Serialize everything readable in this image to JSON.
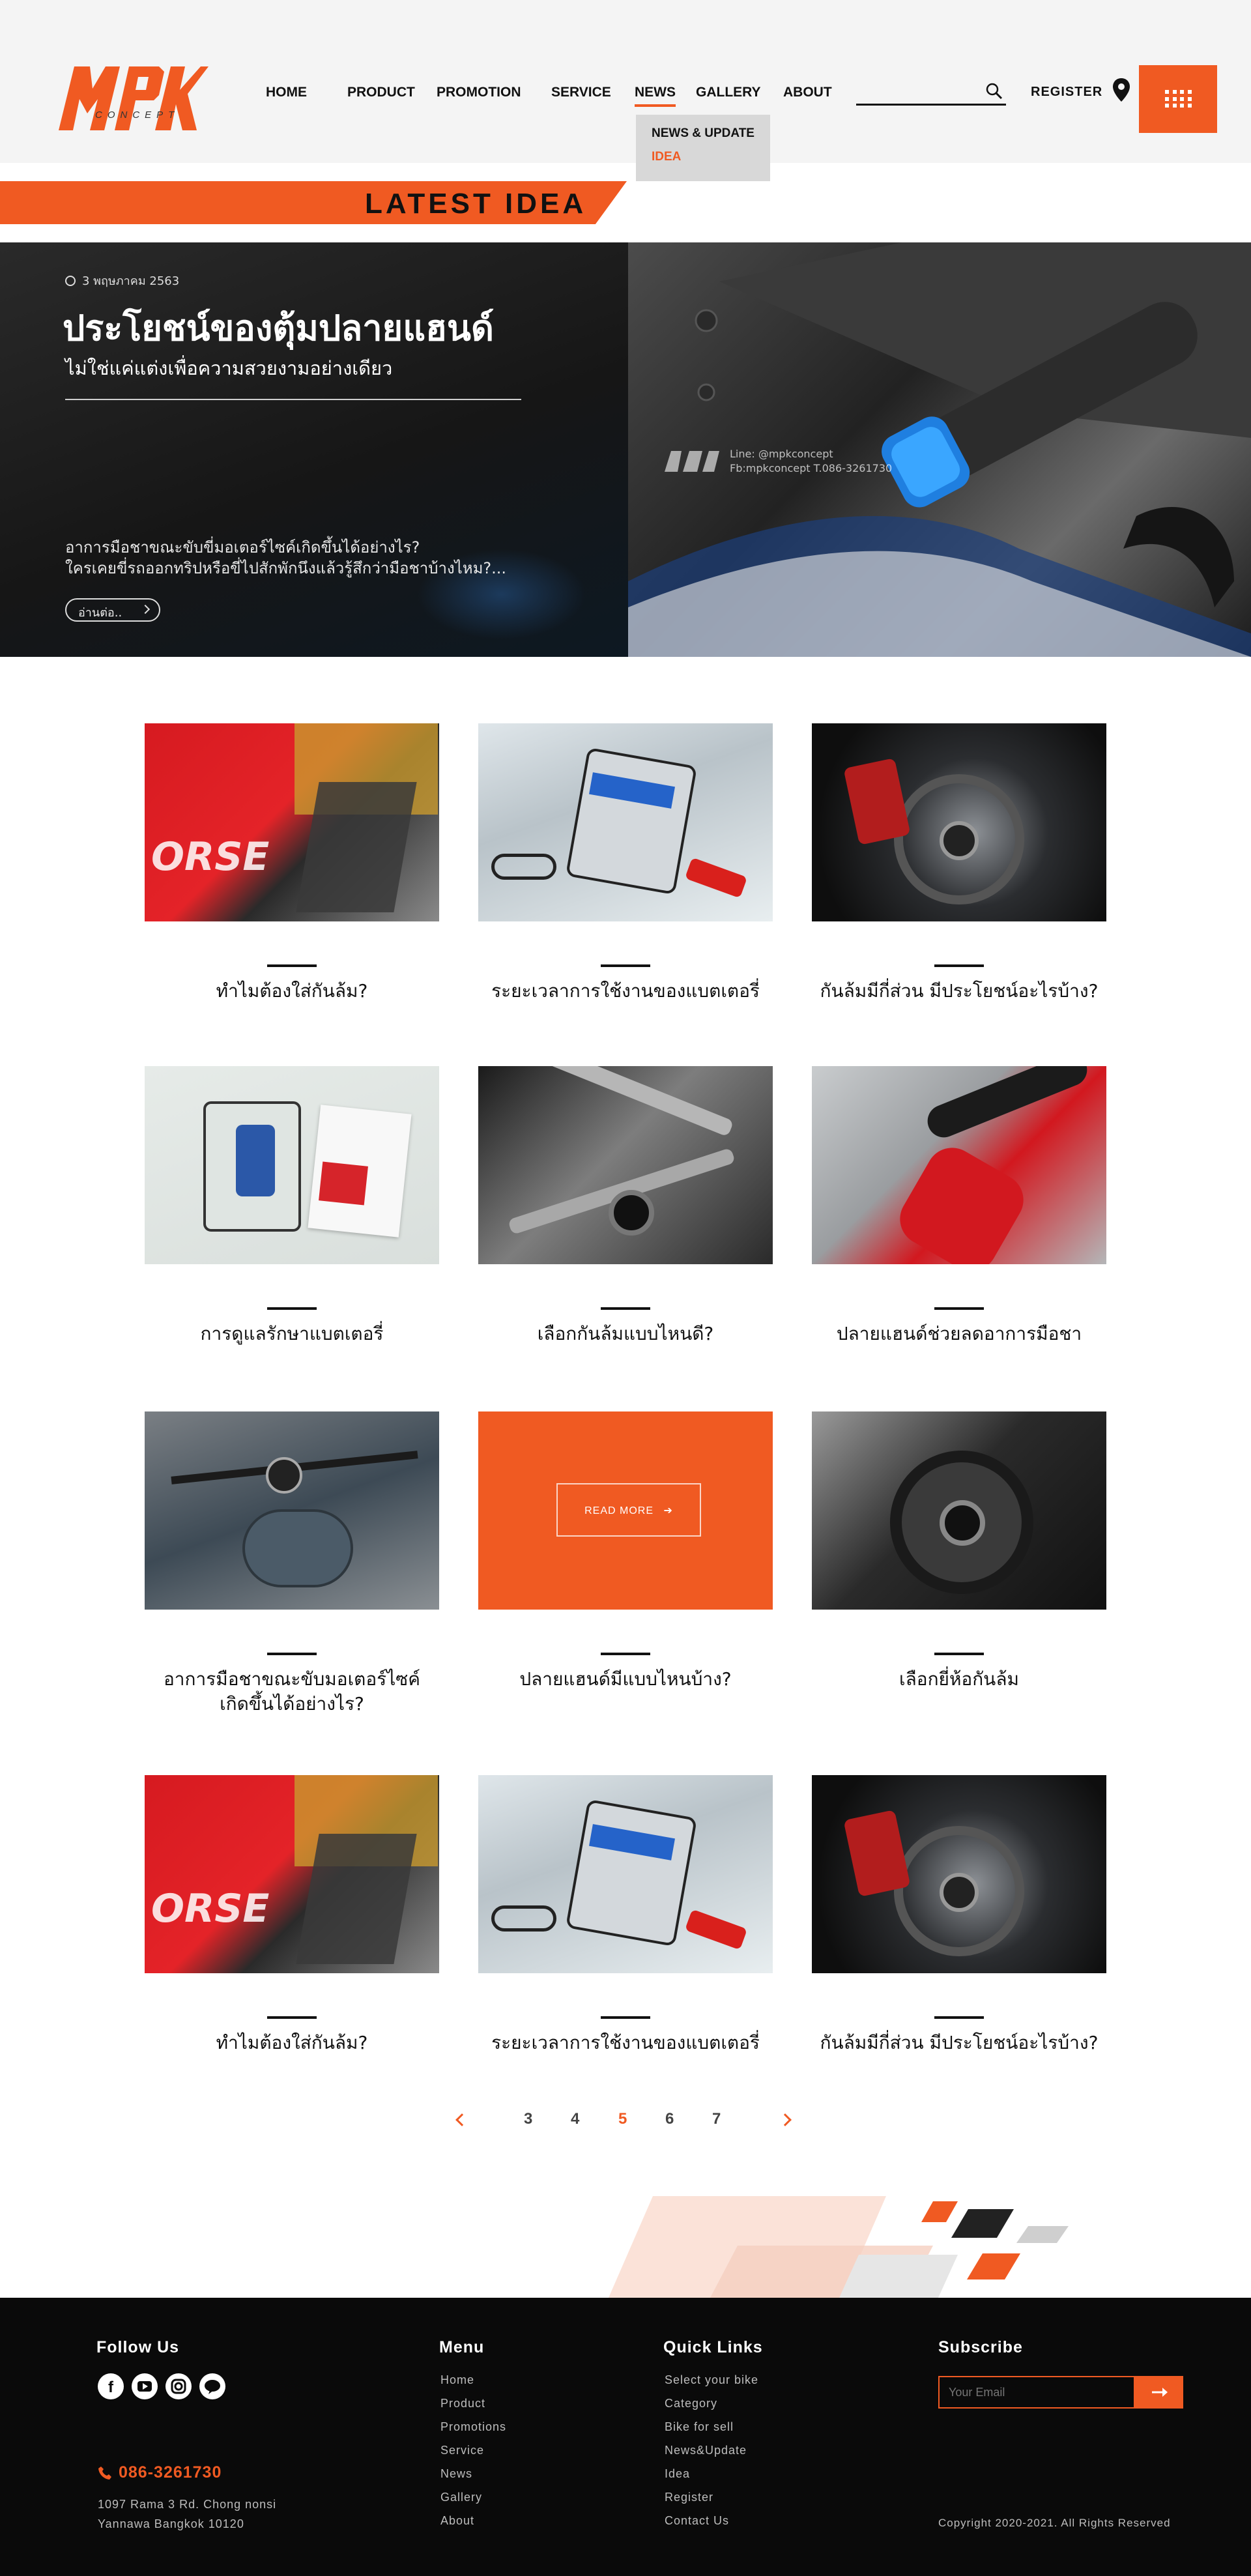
{
  "brand": {
    "logo_text": "MPK",
    "logo_sub": "CONCEPT",
    "accent": "#f05a22"
  },
  "nav": {
    "items": [
      "HOME",
      "PRODUCT",
      "PROMOTION",
      "SERVICE",
      "NEWS",
      "GALLERY",
      "ABOUT"
    ],
    "active": "NEWS",
    "dropdown": [
      "NEWS & UPDATE",
      "IDEA"
    ],
    "search_placeholder": "",
    "register": "REGISTER"
  },
  "section_title": "LATEST IDEA",
  "hero": {
    "date": "3 พฤษภาคม 2563",
    "title": "ประโยชน์ของตุ้มปลายแฮนด์",
    "subtitle": "ไม่ใช่แค่แต่งเพื่อความสวยงามอย่างเดียว",
    "description_line1": "อาการมือชาขณะขับขี่มอเตอร์ไซค์เกิดขึ้นได้อย่างไร?",
    "description_line2": "ใครเคยขี่รถออกทริปหรือขี่ไปสักพักนึงแล้วรู้สึกว่ามือชาบ้างไหม?...",
    "button": "อ่านต่อ..",
    "watermark_line1": "Line: @mpkconcept",
    "watermark_line2": "Fb:mpkconcept T.086-3261730"
  },
  "grid": {
    "cards": [
      {
        "title": "ทำไมต้องใส่กันล้ม?",
        "image": "red-motorcycle-frame-slider"
      },
      {
        "title": "ระยะเวลาการใช้งานของแบตเตอรี่",
        "image": "battery-charger-package"
      },
      {
        "title": "กันล้มมีกี่ส่วน มีประโยชน์อะไรบ้าง?",
        "image": "front-brake-fork-slider"
      },
      {
        "title": "การดูแลรักษาแบตเตอรี่",
        "image": "optimate-charger-kit"
      },
      {
        "title": "เลือกกันล้มแบบไหนดี?",
        "image": "trellis-frame-slider"
      },
      {
        "title": "ปลายแฮนด์ช่วยลดอาการมือชา",
        "image": "bar-end-weight"
      },
      {
        "title_line1": "อาการมือชาขณะขับมอเตอร์ไซค์",
        "title_line2": "เกิดขึ้นได้อย่างไร?",
        "image": "motorcycle-handlebar"
      },
      {
        "title": "ปลายแฮนด์มีแบบไหนบ้าง?",
        "image": "read-more-tile",
        "read_more": "READ MORE"
      },
      {
        "title": "เลือกยี่ห้อกันล้ม",
        "image": "rear-axle-slider"
      },
      {
        "title": "ทำไมต้องใส่กันล้ม?",
        "image": "red-motorcycle-frame-slider"
      },
      {
        "title": "ระยะเวลาการใช้งานของแบตเตอรี่",
        "image": "battery-charger-package"
      },
      {
        "title": "กันล้มมีกี่ส่วน มีประโยชน์อะไรบ้าง?",
        "image": "front-brake-fork-slider"
      }
    ]
  },
  "pagination": {
    "pages": [
      "3",
      "4",
      "5",
      "6",
      "7"
    ],
    "current": "5"
  },
  "footer": {
    "follow_title": "Follow Us",
    "social": [
      "facebook-icon",
      "youtube-icon",
      "instagram-icon",
      "line-icon"
    ],
    "phone": "086-3261730",
    "address_line1": "1097 Rama 3 Rd. Chong nonsi",
    "address_line2": "Yannawa Bangkok 10120",
    "menu_title": "Menu",
    "menu": [
      "Home",
      "Product",
      "Promotions",
      "Service",
      "News",
      "Gallery",
      "About"
    ],
    "quick_title": "Quick Links",
    "quick": [
      "Select your bike",
      "Category",
      "Bike for sell",
      "News&Update",
      "Idea",
      "Register",
      "Contact Us"
    ],
    "subscribe_title": "Subscribe",
    "email_placeholder": "Your Email",
    "copyright": "Copyright 2020-2021. All Rights Reserved"
  }
}
